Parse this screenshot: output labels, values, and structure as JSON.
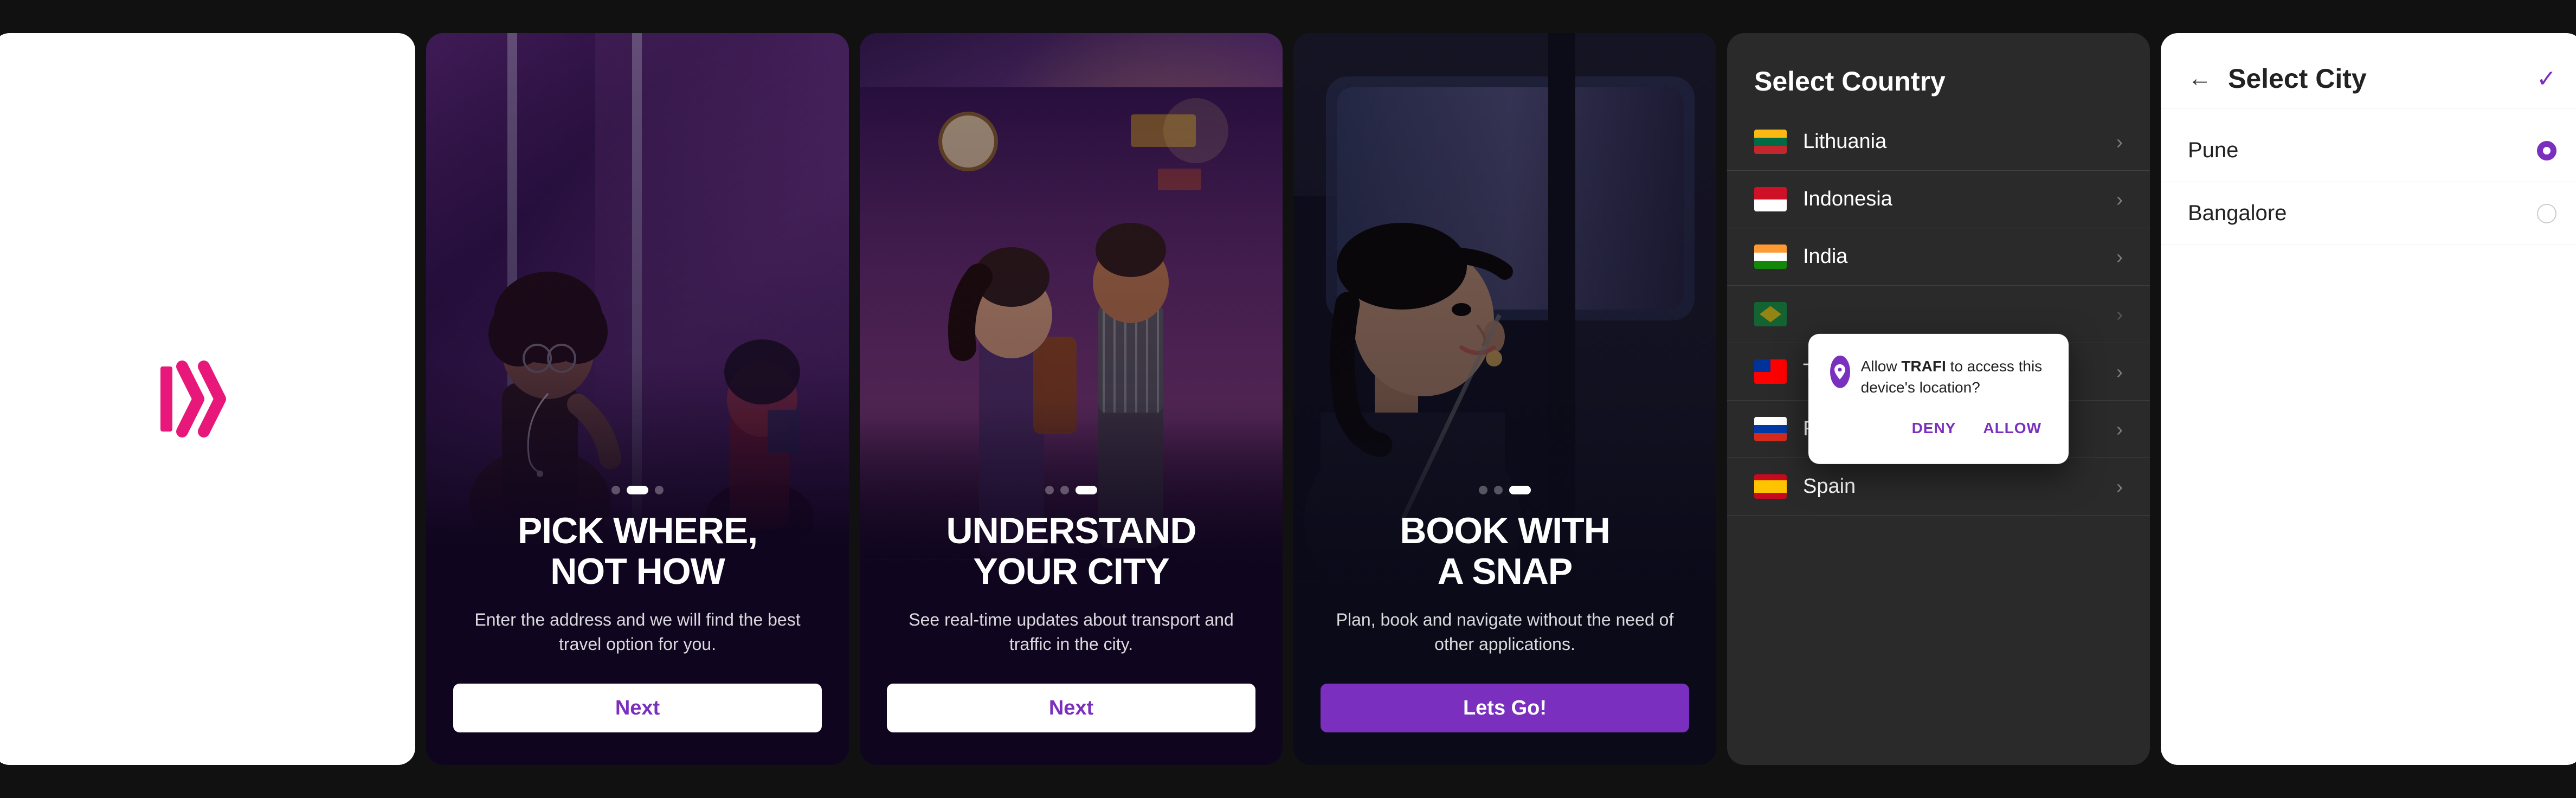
{
  "screen1": {
    "logo_alt": "Trafi logo"
  },
  "screen2": {
    "title": "PICK WHERE,\nNOT HOW",
    "subtitle": "Enter the address and we will find the best travel option for you.",
    "button_label": "Next"
  },
  "screen3": {
    "title": "UNDERSTAND\nYOUR CITY",
    "subtitle": "See real-time updates about transport and traffic in the city.",
    "button_label": "Next"
  },
  "screen4": {
    "title": "BOOK WITH\nA SNAP",
    "subtitle": "Plan, book and navigate without the need of other applications.",
    "button_label": "Lets Go!"
  },
  "screen5": {
    "header": "Select Country",
    "countries": [
      {
        "name": "Lithuania",
        "flag_type": "lt"
      },
      {
        "name": "Indonesia",
        "flag_type": "id"
      },
      {
        "name": "India",
        "flag_type": "in"
      },
      {
        "name": "",
        "flag_type": "br"
      },
      {
        "name": "Taiwan",
        "flag_type": "tw"
      },
      {
        "name": "Russia",
        "flag_type": "ru"
      },
      {
        "name": "Spain",
        "flag_type": "es"
      }
    ],
    "popup": {
      "app_name": "TRAFI",
      "text_before": "Allow ",
      "text_after": " to access this device's location?",
      "deny_label": "DENY",
      "allow_label": "ALLOW"
    }
  },
  "screen6": {
    "title": "Select City",
    "back_icon": "←",
    "check_icon": "✓",
    "cities": [
      {
        "name": "Pune",
        "selected": true
      },
      {
        "name": "Bangalore",
        "selected": false
      }
    ]
  }
}
